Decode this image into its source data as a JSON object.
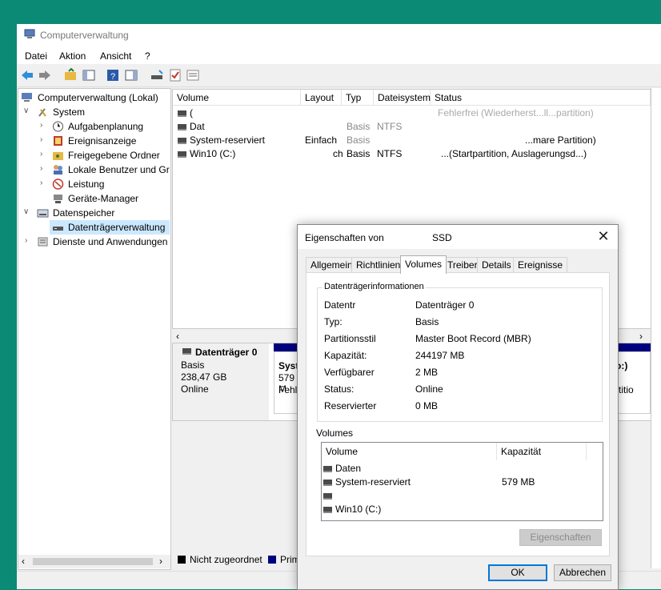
{
  "window": {
    "title": "Computerverwaltung"
  },
  "menu": [
    "Datei",
    "Aktion",
    "Ansicht",
    "?"
  ],
  "tree": {
    "root": "Computerverwaltung (Lokal)",
    "system": "System",
    "aufgabenplanung": "Aufgabenplanung",
    "ereignisanzeige": "Ereignisanzeige",
    "freigegebene": "Freigegebene Ordner",
    "lokale": "Lokale Benutzer und Gr",
    "leistung": "Leistung",
    "geraete": "Geräte-Manager",
    "datenspeicher": "Datenspeicher",
    "datentraeger": "Datenträgerverwaltung",
    "dienste": "Dienste und Anwendungen"
  },
  "volumes": {
    "headers": [
      "Volume",
      "Layout",
      "Typ",
      "Dateisystem",
      "Status"
    ],
    "rows": [
      {
        "volume": "(",
        "layout": "",
        "typ": "",
        "fs": "",
        "status": "Fehlerfrei (Wiederherst...ll...partition)"
      },
      {
        "volume": "Dat",
        "layout": "",
        "typ": "Basis",
        "fs": "NTFS",
        "status": ""
      },
      {
        "volume": "System-reserviert",
        "layout": "Einfach",
        "typ": "Basis",
        "fs": "",
        "status": "...mare Partition)"
      },
      {
        "volume": "Win10 (C:)",
        "layout": "ch",
        "typ": "Basis",
        "fs": "NTFS",
        "status": "...(Startpartition, Auslagerungsd...)"
      }
    ]
  },
  "disk": {
    "name": "Datenträger 0",
    "type": "Basis",
    "size": "238,47 GB",
    "state": "Online",
    "part1_label": "Syst",
    "part1_size": "579 M",
    "part1_status": "Fehle",
    "part_right_label": "o:)",
    "part_right_status": "rtitio"
  },
  "legend": {
    "unassigned": "Nicht zugeordnet",
    "primary": "Prim"
  },
  "dialog": {
    "title": "Eigenschaften von",
    "device": "SSD",
    "tabs": [
      "Allgemein",
      "Richtlinien",
      "Volumes",
      "Treiber",
      "Details",
      "Ereignisse"
    ],
    "active_tab": "Volumes",
    "group_label": "Datenträgerinformationen",
    "info": [
      {
        "key": "Datentr",
        "value": "Datenträger 0"
      },
      {
        "key": "Typ:",
        "value": "Basis"
      },
      {
        "key": "Partitionsstil",
        "value": "Master Boot Record (MBR)"
      },
      {
        "key": "Kapazität:",
        "value": "244197 MB"
      },
      {
        "key": "Verfügbarer",
        "value": "2 MB"
      },
      {
        "key": "Status:",
        "value": "Online"
      },
      {
        "key": "Reservierter",
        "value": "0 MB"
      }
    ],
    "volumes_label": "Volumes",
    "list_headers": [
      "Volume",
      "Kapazität"
    ],
    "list": [
      {
        "name": "Daten",
        "cap": ""
      },
      {
        "name": "System-reserviert",
        "cap": "579 MB"
      },
      {
        "name": "",
        "cap": ""
      },
      {
        "name": "Win10 (C:)",
        "cap": ""
      }
    ],
    "properties_button": "Eigenschaften",
    "ok": "OK",
    "cancel": "Abbrechen"
  },
  "colors": {
    "accent": "#0078d7",
    "desktop": "#0b8a75",
    "primary_partition": "#00007f"
  }
}
